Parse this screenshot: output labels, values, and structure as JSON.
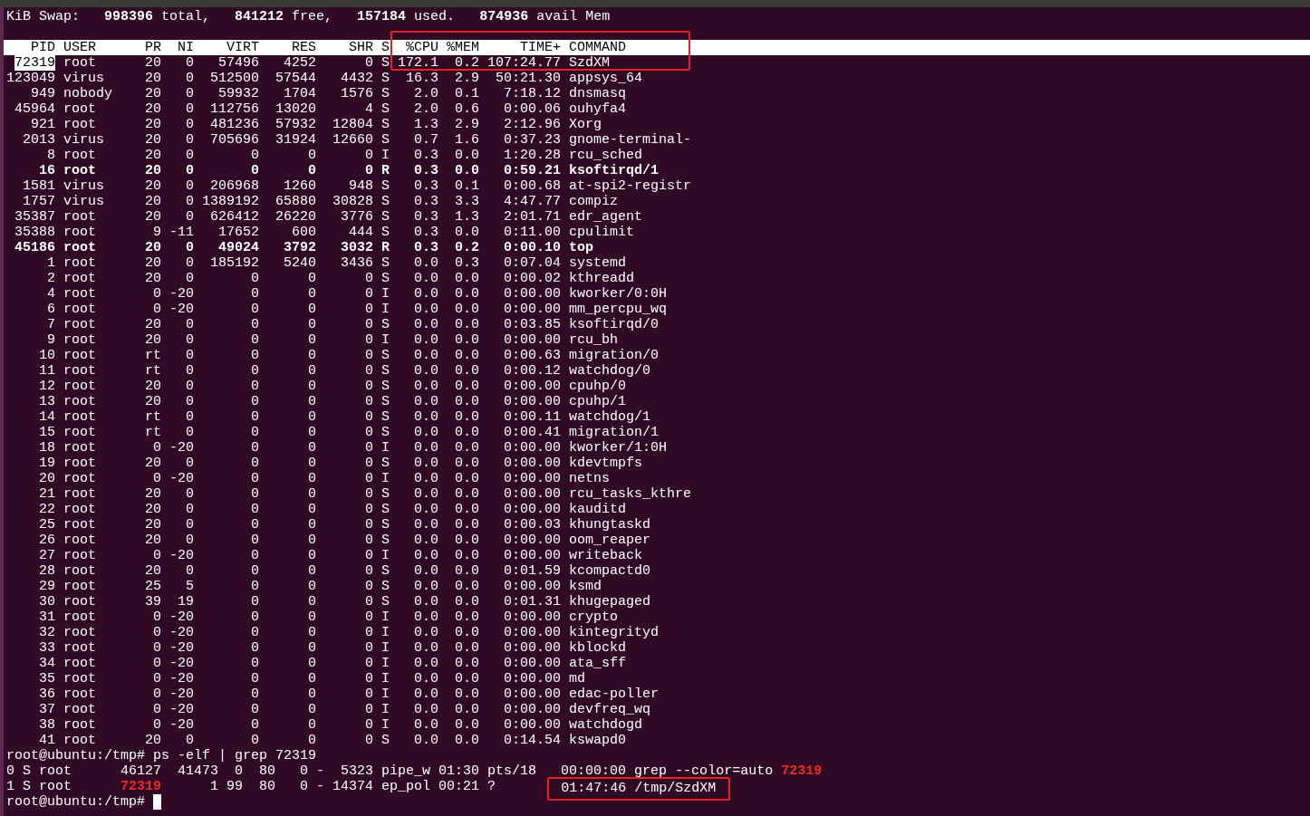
{
  "swap_line": "KiB Swap:   **998396** total,   **841212** free,   **157184** used.   **874936** avail Mem",
  "columns": [
    "PID",
    "USER",
    "PR",
    "NI",
    "VIRT",
    "RES",
    "SHR",
    "S",
    "%CPU",
    "%MEM",
    "TIME+",
    "COMMAND"
  ],
  "rows": [
    {
      "cells": [
        "72319",
        "root",
        "20",
        "0",
        "57496",
        "4252",
        "0",
        "S",
        "172.1",
        "0.2",
        "107:24.77",
        "SzdXM"
      ],
      "bold": false,
      "marked": true
    },
    {
      "cells": [
        "123049",
        "virus",
        "20",
        "0",
        "512500",
        "57544",
        "4432",
        "S",
        "16.3",
        "2.9",
        "50:21.30",
        "appsys_64"
      ],
      "bold": false,
      "marked": false
    },
    {
      "cells": [
        "949",
        "nobody",
        "20",
        "0",
        "59932",
        "1704",
        "1576",
        "S",
        "2.0",
        "0.1",
        "7:18.12",
        "dnsmasq"
      ],
      "bold": false,
      "marked": false
    },
    {
      "cells": [
        "45964",
        "root",
        "20",
        "0",
        "112756",
        "13020",
        "4",
        "S",
        "2.0",
        "0.6",
        "0:00.06",
        "ouhyfa4"
      ],
      "bold": false,
      "marked": false
    },
    {
      "cells": [
        "921",
        "root",
        "20",
        "0",
        "481236",
        "57932",
        "12804",
        "S",
        "1.3",
        "2.9",
        "2:12.96",
        "Xorg"
      ],
      "bold": false,
      "marked": false
    },
    {
      "cells": [
        "2013",
        "virus",
        "20",
        "0",
        "705696",
        "31924",
        "12660",
        "S",
        "0.7",
        "1.6",
        "0:37.23",
        "gnome-terminal-"
      ],
      "bold": false,
      "marked": false
    },
    {
      "cells": [
        "8",
        "root",
        "20",
        "0",
        "0",
        "0",
        "0",
        "I",
        "0.3",
        "0.0",
        "1:20.28",
        "rcu_sched"
      ],
      "bold": false,
      "marked": false
    },
    {
      "cells": [
        "16",
        "root",
        "20",
        "0",
        "0",
        "0",
        "0",
        "R",
        "0.3",
        "0.0",
        "0:59.21",
        "ksoftirqd/1"
      ],
      "bold": true,
      "marked": false
    },
    {
      "cells": [
        "1581",
        "virus",
        "20",
        "0",
        "206968",
        "1260",
        "948",
        "S",
        "0.3",
        "0.1",
        "0:00.68",
        "at-spi2-registr"
      ],
      "bold": false,
      "marked": false
    },
    {
      "cells": [
        "1757",
        "virus",
        "20",
        "0",
        "1389192",
        "65880",
        "30828",
        "S",
        "0.3",
        "3.3",
        "4:47.77",
        "compiz"
      ],
      "bold": false,
      "marked": false
    },
    {
      "cells": [
        "35387",
        "root",
        "20",
        "0",
        "626412",
        "26220",
        "3776",
        "S",
        "0.3",
        "1.3",
        "2:01.71",
        "edr_agent"
      ],
      "bold": false,
      "marked": false
    },
    {
      "cells": [
        "35388",
        "root",
        "9",
        "-11",
        "17652",
        "600",
        "444",
        "S",
        "0.3",
        "0.0",
        "0:11.00",
        "cpulimit"
      ],
      "bold": false,
      "marked": false
    },
    {
      "cells": [
        "45186",
        "root",
        "20",
        "0",
        "49024",
        "3792",
        "3032",
        "R",
        "0.3",
        "0.2",
        "0:00.10",
        "top"
      ],
      "bold": true,
      "marked": false
    },
    {
      "cells": [
        "1",
        "root",
        "20",
        "0",
        "185192",
        "5240",
        "3436",
        "S",
        "0.0",
        "0.3",
        "0:07.04",
        "systemd"
      ],
      "bold": false,
      "marked": false
    },
    {
      "cells": [
        "2",
        "root",
        "20",
        "0",
        "0",
        "0",
        "0",
        "S",
        "0.0",
        "0.0",
        "0:00.02",
        "kthreadd"
      ],
      "bold": false,
      "marked": false
    },
    {
      "cells": [
        "4",
        "root",
        "0",
        "-20",
        "0",
        "0",
        "0",
        "I",
        "0.0",
        "0.0",
        "0:00.00",
        "kworker/0:0H"
      ],
      "bold": false,
      "marked": false
    },
    {
      "cells": [
        "6",
        "root",
        "0",
        "-20",
        "0",
        "0",
        "0",
        "I",
        "0.0",
        "0.0",
        "0:00.00",
        "mm_percpu_wq"
      ],
      "bold": false,
      "marked": false
    },
    {
      "cells": [
        "7",
        "root",
        "20",
        "0",
        "0",
        "0",
        "0",
        "S",
        "0.0",
        "0.0",
        "0:03.85",
        "ksoftirqd/0"
      ],
      "bold": false,
      "marked": false
    },
    {
      "cells": [
        "9",
        "root",
        "20",
        "0",
        "0",
        "0",
        "0",
        "I",
        "0.0",
        "0.0",
        "0:00.00",
        "rcu_bh"
      ],
      "bold": false,
      "marked": false
    },
    {
      "cells": [
        "10",
        "root",
        "rt",
        "0",
        "0",
        "0",
        "0",
        "S",
        "0.0",
        "0.0",
        "0:00.63",
        "migration/0"
      ],
      "bold": false,
      "marked": false
    },
    {
      "cells": [
        "11",
        "root",
        "rt",
        "0",
        "0",
        "0",
        "0",
        "S",
        "0.0",
        "0.0",
        "0:00.12",
        "watchdog/0"
      ],
      "bold": false,
      "marked": false
    },
    {
      "cells": [
        "12",
        "root",
        "20",
        "0",
        "0",
        "0",
        "0",
        "S",
        "0.0",
        "0.0",
        "0:00.00",
        "cpuhp/0"
      ],
      "bold": false,
      "marked": false
    },
    {
      "cells": [
        "13",
        "root",
        "20",
        "0",
        "0",
        "0",
        "0",
        "S",
        "0.0",
        "0.0",
        "0:00.00",
        "cpuhp/1"
      ],
      "bold": false,
      "marked": false
    },
    {
      "cells": [
        "14",
        "root",
        "rt",
        "0",
        "0",
        "0",
        "0",
        "S",
        "0.0",
        "0.0",
        "0:00.11",
        "watchdog/1"
      ],
      "bold": false,
      "marked": false
    },
    {
      "cells": [
        "15",
        "root",
        "rt",
        "0",
        "0",
        "0",
        "0",
        "S",
        "0.0",
        "0.0",
        "0:00.41",
        "migration/1"
      ],
      "bold": false,
      "marked": false
    },
    {
      "cells": [
        "18",
        "root",
        "0",
        "-20",
        "0",
        "0",
        "0",
        "I",
        "0.0",
        "0.0",
        "0:00.00",
        "kworker/1:0H"
      ],
      "bold": false,
      "marked": false
    },
    {
      "cells": [
        "19",
        "root",
        "20",
        "0",
        "0",
        "0",
        "0",
        "S",
        "0.0",
        "0.0",
        "0:00.00",
        "kdevtmpfs"
      ],
      "bold": false,
      "marked": false
    },
    {
      "cells": [
        "20",
        "root",
        "0",
        "-20",
        "0",
        "0",
        "0",
        "I",
        "0.0",
        "0.0",
        "0:00.00",
        "netns"
      ],
      "bold": false,
      "marked": false
    },
    {
      "cells": [
        "21",
        "root",
        "20",
        "0",
        "0",
        "0",
        "0",
        "S",
        "0.0",
        "0.0",
        "0:00.00",
        "rcu_tasks_kthre"
      ],
      "bold": false,
      "marked": false
    },
    {
      "cells": [
        "22",
        "root",
        "20",
        "0",
        "0",
        "0",
        "0",
        "S",
        "0.0",
        "0.0",
        "0:00.00",
        "kauditd"
      ],
      "bold": false,
      "marked": false
    },
    {
      "cells": [
        "25",
        "root",
        "20",
        "0",
        "0",
        "0",
        "0",
        "S",
        "0.0",
        "0.0",
        "0:00.03",
        "khungtaskd"
      ],
      "bold": false,
      "marked": false
    },
    {
      "cells": [
        "26",
        "root",
        "20",
        "0",
        "0",
        "0",
        "0",
        "S",
        "0.0",
        "0.0",
        "0:00.00",
        "oom_reaper"
      ],
      "bold": false,
      "marked": false
    },
    {
      "cells": [
        "27",
        "root",
        "0",
        "-20",
        "0",
        "0",
        "0",
        "I",
        "0.0",
        "0.0",
        "0:00.00",
        "writeback"
      ],
      "bold": false,
      "marked": false
    },
    {
      "cells": [
        "28",
        "root",
        "20",
        "0",
        "0",
        "0",
        "0",
        "S",
        "0.0",
        "0.0",
        "0:01.59",
        "kcompactd0"
      ],
      "bold": false,
      "marked": false
    },
    {
      "cells": [
        "29",
        "root",
        "25",
        "5",
        "0",
        "0",
        "0",
        "S",
        "0.0",
        "0.0",
        "0:00.00",
        "ksmd"
      ],
      "bold": false,
      "marked": false
    },
    {
      "cells": [
        "30",
        "root",
        "39",
        "19",
        "0",
        "0",
        "0",
        "S",
        "0.0",
        "0.0",
        "0:01.31",
        "khugepaged"
      ],
      "bold": false,
      "marked": false
    },
    {
      "cells": [
        "31",
        "root",
        "0",
        "-20",
        "0",
        "0",
        "0",
        "I",
        "0.0",
        "0.0",
        "0:00.00",
        "crypto"
      ],
      "bold": false,
      "marked": false
    },
    {
      "cells": [
        "32",
        "root",
        "0",
        "-20",
        "0",
        "0",
        "0",
        "I",
        "0.0",
        "0.0",
        "0:00.00",
        "kintegrityd"
      ],
      "bold": false,
      "marked": false
    },
    {
      "cells": [
        "33",
        "root",
        "0",
        "-20",
        "0",
        "0",
        "0",
        "I",
        "0.0",
        "0.0",
        "0:00.00",
        "kblockd"
      ],
      "bold": false,
      "marked": false
    },
    {
      "cells": [
        "34",
        "root",
        "0",
        "-20",
        "0",
        "0",
        "0",
        "I",
        "0.0",
        "0.0",
        "0:00.00",
        "ata_sff"
      ],
      "bold": false,
      "marked": false
    },
    {
      "cells": [
        "35",
        "root",
        "0",
        "-20",
        "0",
        "0",
        "0",
        "I",
        "0.0",
        "0.0",
        "0:00.00",
        "md"
      ],
      "bold": false,
      "marked": false
    },
    {
      "cells": [
        "36",
        "root",
        "0",
        "-20",
        "0",
        "0",
        "0",
        "I",
        "0.0",
        "0.0",
        "0:00.00",
        "edac-poller"
      ],
      "bold": false,
      "marked": false
    },
    {
      "cells": [
        "37",
        "root",
        "0",
        "-20",
        "0",
        "0",
        "0",
        "I",
        "0.0",
        "0.0",
        "0:00.00",
        "devfreq_wq"
      ],
      "bold": false,
      "marked": false
    },
    {
      "cells": [
        "38",
        "root",
        "0",
        "-20",
        "0",
        "0",
        "0",
        "I",
        "0.0",
        "0.0",
        "0:00.00",
        "watchdogd"
      ],
      "bold": false,
      "marked": false
    },
    {
      "cells": [
        "41",
        "root",
        "20",
        "0",
        "0",
        "0",
        "0",
        "S",
        "0.0",
        "0.0",
        "0:14.54",
        "kswapd0"
      ],
      "bold": false,
      "marked": false
    }
  ],
  "shell_lines": [
    {
      "parts": [
        {
          "text": "root@ubuntu:/tmp# ps -elf | grep 72319",
          "match": false,
          "framed": false
        }
      ],
      "cursor": false
    },
    {
      "parts": [
        {
          "text": "0 S root      46127  41473  0  80   0 -  5323 pipe_w 01:30 pts/18   00:00:00 grep --color=auto ",
          "match": false,
          "framed": false
        },
        {
          "text": "72319",
          "match": true,
          "framed": false
        }
      ],
      "cursor": false
    },
    {
      "parts": [
        {
          "text": "1 S root      ",
          "match": false,
          "framed": false
        },
        {
          "text": "72319",
          "match": true,
          "framed": false
        },
        {
          "text": "      1 99  80   0 - 14374 ep_pol 00:21 ?        ",
          "match": false,
          "framed": false
        },
        {
          "text": "01:47:46 /tmp/SzdXM",
          "match": false,
          "framed": true
        }
      ],
      "cursor": false
    },
    {
      "parts": [
        {
          "text": "root@ubuntu:/tmp# ",
          "match": false,
          "framed": false
        }
      ],
      "cursor": true
    }
  ]
}
